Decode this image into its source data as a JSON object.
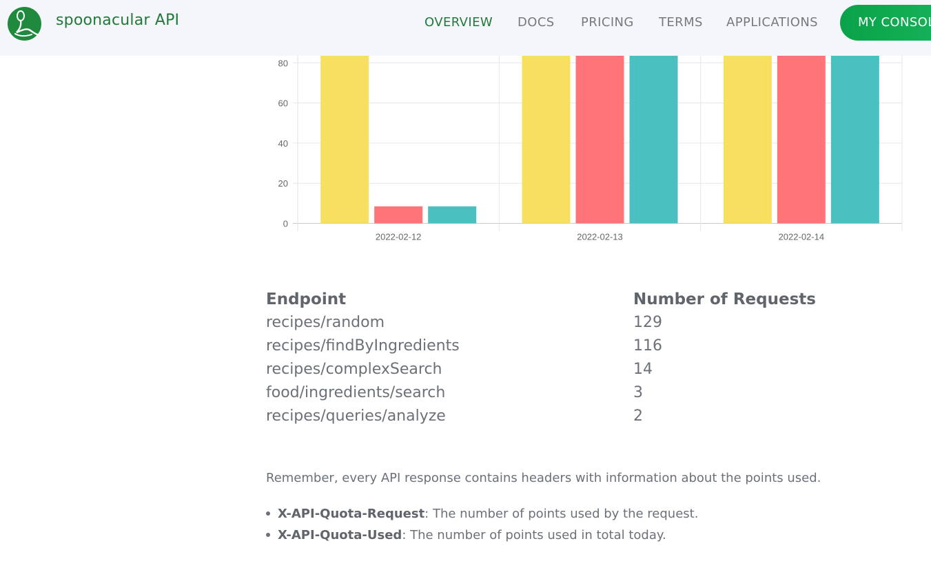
{
  "header": {
    "brand": "spoonacular API",
    "nav": [
      "OVERVIEW",
      "DOCS",
      "PRICING",
      "TERMS",
      "APPLICATIONS"
    ],
    "active_nav": "OVERVIEW",
    "console_button": "MY CONSOLE"
  },
  "chart_data": {
    "type": "bar",
    "categories": [
      "2022-02-12",
      "2022-02-13",
      "2022-02-14"
    ],
    "series": [
      {
        "color": "#f7df60",
        "values": [
          84,
          84,
          84
        ]
      },
      {
        "color": "#ff7479",
        "values": [
          8.5,
          84,
          84
        ]
      },
      {
        "color": "#4bc0c0",
        "values": [
          8.5,
          84,
          84
        ]
      }
    ],
    "y_ticks": [
      "0",
      "20",
      "40",
      "60",
      "80"
    ],
    "ylim": [
      0,
      80
    ],
    "grid": true,
    "note": "chart is scrolled; bars on 2022-02-13 and 2022-02-14 and yellow bar on 2022-02-12 extend above the visible area"
  },
  "table": {
    "headers": [
      "Endpoint",
      "Number of Requests"
    ],
    "rows": [
      [
        "recipes/random",
        "129"
      ],
      [
        "recipes/findByIngredients",
        "116"
      ],
      [
        "recipes/complexSearch",
        "14"
      ],
      [
        "food/ingredients/search",
        "3"
      ],
      [
        "recipes/queries/analyze",
        "2"
      ]
    ]
  },
  "notes": {
    "intro": "Remember, every API response contains headers with information about the points used.",
    "items": [
      {
        "name": "X-API-Quota-Request",
        "desc": ": The number of points used by the request."
      },
      {
        "name": "X-API-Quota-Used",
        "desc": ": The number of points used in total today."
      }
    ]
  }
}
